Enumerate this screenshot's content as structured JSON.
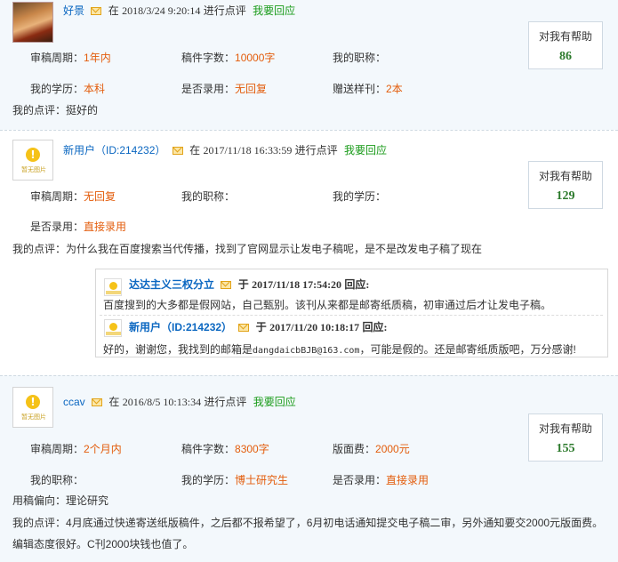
{
  "reviews": [
    {
      "author": "好景",
      "at_label": "在",
      "datetime": "2018/3/24 9:20:14",
      "action": "进行点评",
      "reply_link": "我要回应",
      "help_label": "对我有帮助",
      "help_count": "86",
      "fields": [
        {
          "label": "审稿周期：",
          "value": "1年内"
        },
        {
          "label": "稿件字数：",
          "value": "10000字"
        },
        {
          "label": "我的职称：",
          "value": ""
        },
        {
          "label": "我的学历：",
          "value": "本科"
        },
        {
          "label": "是否录用：",
          "value": "无回复"
        },
        {
          "label": "赠送样刊：",
          "value": "2本"
        }
      ],
      "comment_label": "我的点评：",
      "comment": "挺好的"
    },
    {
      "author": "新用户（ID:214232）",
      "at_label": "在",
      "datetime": "2017/11/18 16:33:59",
      "action": "进行点评",
      "reply_link": "我要回应",
      "help_label": "对我有帮助",
      "help_count": "129",
      "avatar_caption": "暂无图片",
      "fields": [
        {
          "label": "审稿周期：",
          "value": "无回复"
        },
        {
          "label": "我的职称：",
          "value": ""
        },
        {
          "label": "我的学历：",
          "value": ""
        },
        {
          "label": "是否录用：",
          "value": "直接录用"
        }
      ],
      "comment_label": "我的点评：",
      "comment": "为什么我在百度搜索当代传播，找到了官网显示让发电子稿呢，是不是改发电子稿了现在",
      "replies": [
        {
          "author": "达达主义三权分立",
          "at_label": "于",
          "datetime": "2017/11/18 17:54:20",
          "action": "回应:",
          "text": "百度搜到的大多都是假网站，自己甄别。该刊从来都是邮寄纸质稿，初审通过后才让发电子稿。"
        },
        {
          "author": "新用户（ID:214232）",
          "at_label": "于",
          "datetime": "2017/11/20 10:18:17",
          "action": "回应:",
          "text_before": "好的，谢谢您，我找到的邮箱是",
          "email": "dangdaicbBJB@163.com",
          "text_after": "，可能是假的。还是邮寄纸质版吧，万分感谢!"
        }
      ]
    },
    {
      "author": "ccav",
      "at_label": "在",
      "datetime": "2016/8/5 10:13:34",
      "action": "进行点评",
      "reply_link": "我要回应",
      "help_label": "对我有帮助",
      "help_count": "155",
      "avatar_caption": "暂无图片",
      "fields": [
        {
          "label": "审稿周期：",
          "value": "2个月内"
        },
        {
          "label": "稿件字数：",
          "value": "8300字"
        },
        {
          "label": "版面费：",
          "value": "2000元"
        },
        {
          "label": "我的职称：",
          "value": ""
        },
        {
          "label": "我的学历：",
          "value": "博士研究生"
        },
        {
          "label": "是否录用：",
          "value": "直接录用"
        }
      ],
      "pref_label": "用稿偏向：",
      "pref": "理论研究",
      "comment_label": "我的点评：",
      "comment_line1": "4月底通过快递寄送纸版稿件，之后都不报希望了，6月初电话通知提交电子稿二审，另外通知要交2000元版面费。",
      "comment_line2": "编辑态度很好。C刊2000块钱也值了。"
    }
  ]
}
